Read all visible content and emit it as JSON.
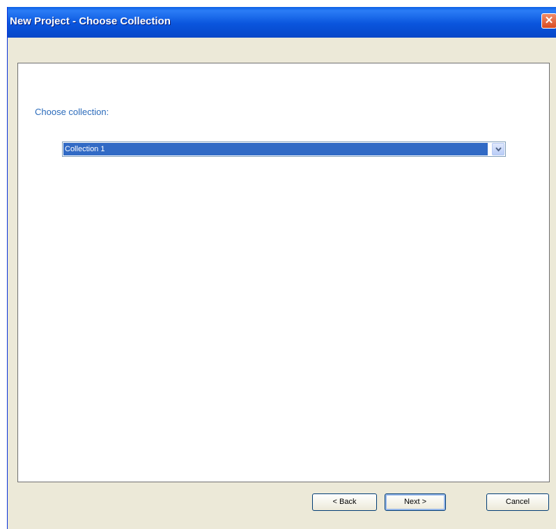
{
  "window": {
    "title": "New Project - Choose Collection",
    "close_label": "✕"
  },
  "content": {
    "choose_label": "Choose collection:",
    "collection_select": {
      "selected": "Collection 1"
    }
  },
  "footer": {
    "back_label": "< Back",
    "next_label": "Next >",
    "cancel_label": "Cancel"
  },
  "colors": {
    "titlebar": "#0a55dd",
    "label_blue": "#2b6bbb",
    "selection": "#316ac5",
    "dialog_bg": "#ece9d8"
  }
}
